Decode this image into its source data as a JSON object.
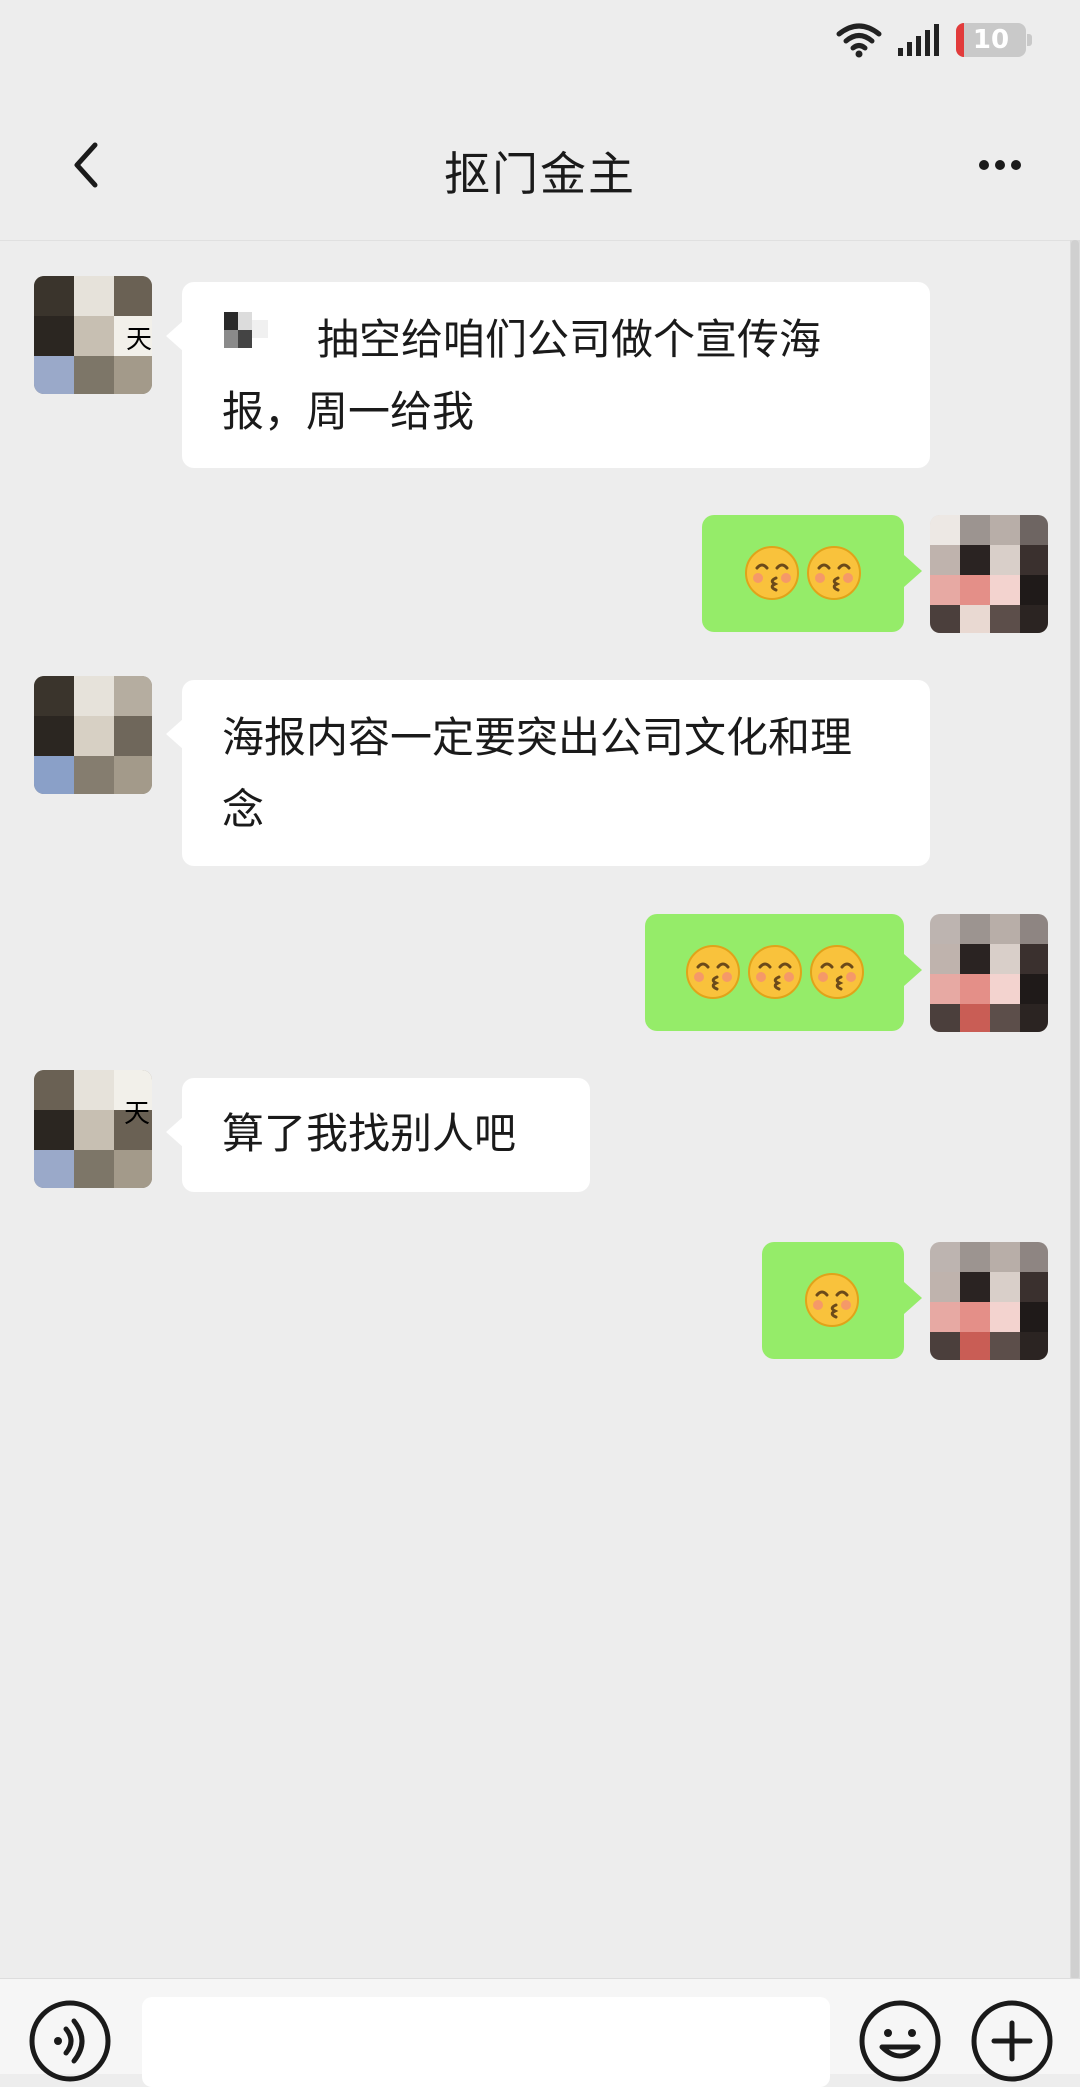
{
  "status_bar": {
    "battery": "10"
  },
  "header": {
    "title": "抠门金主"
  },
  "messages": [
    {
      "side": "in",
      "text": "抽空给咱们公司做个宣传海报，周一给我"
    },
    {
      "side": "out",
      "emoji_count": 2,
      "emoji": "kissing-smiling-eyes"
    },
    {
      "side": "in",
      "text": "海报内容一定要突出公司文化和理念"
    },
    {
      "side": "out",
      "emoji_count": 3,
      "emoji": "kissing-smiling-eyes"
    },
    {
      "side": "in",
      "text": "算了我找别人吧"
    },
    {
      "side": "out",
      "emoji_count": 1,
      "emoji": "kissing-smiling-eyes"
    }
  ],
  "input_bar": {
    "value": ""
  },
  "colors": {
    "background": "#ededed",
    "incoming_bubble": "#ffffff",
    "outgoing_bubble": "#95ec69"
  },
  "icons": [
    "back-chevron-icon",
    "more-icon",
    "voice-icon",
    "emoji-icon",
    "plus-icon",
    "wifi-icon",
    "signal-icon",
    "battery-icon"
  ]
}
